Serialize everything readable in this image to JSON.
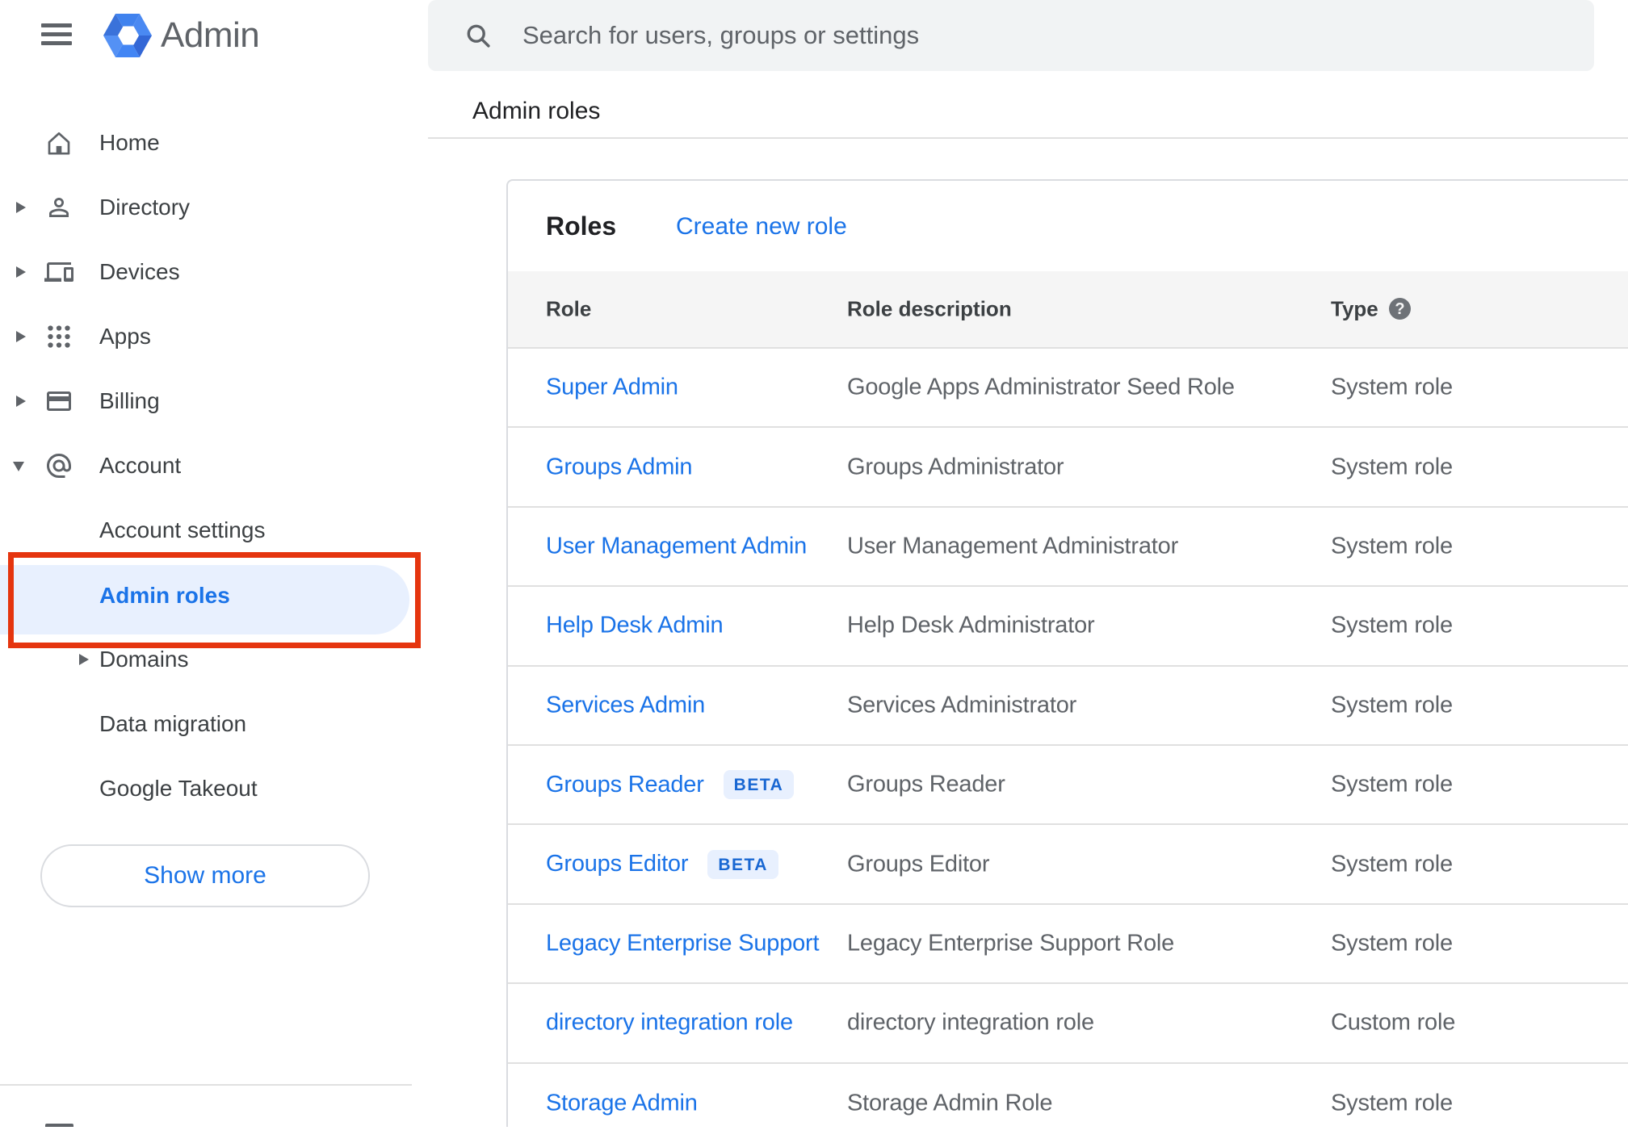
{
  "topbar": {
    "app_name": "Admin",
    "search_placeholder": "Search for users, groups or settings"
  },
  "breadcrumb": "Admin roles",
  "sidebar": {
    "items": [
      {
        "label": "Home",
        "icon": "home-icon",
        "expandable": false
      },
      {
        "label": "Directory",
        "icon": "person-icon",
        "expandable": true
      },
      {
        "label": "Devices",
        "icon": "devices-icon",
        "expandable": true
      },
      {
        "label": "Apps",
        "icon": "apps-grid-icon",
        "expandable": true
      },
      {
        "label": "Billing",
        "icon": "credit-card-icon",
        "expandable": true
      },
      {
        "label": "Account",
        "icon": "at-sign-icon",
        "expandable": true,
        "expanded": true
      }
    ],
    "account_sub_items": [
      {
        "label": "Account settings",
        "expandable": false,
        "selected": false
      },
      {
        "label": "Admin roles",
        "expandable": false,
        "selected": true
      },
      {
        "label": "Domains",
        "expandable": true,
        "selected": false
      },
      {
        "label": "Data migration",
        "expandable": false,
        "selected": false
      },
      {
        "label": "Google Takeout",
        "expandable": false,
        "selected": false
      }
    ],
    "show_more_label": "Show more"
  },
  "main": {
    "heading": "Roles",
    "create_link": "Create new role",
    "table": {
      "columns": [
        "Role",
        "Role description",
        "Type"
      ],
      "help_icon": "?",
      "rows": [
        {
          "role": "Super Admin",
          "description": "Google Apps Administrator Seed Role",
          "type": "System role"
        },
        {
          "role": "Groups Admin",
          "description": "Groups Administrator",
          "type": "System role"
        },
        {
          "role": "User Management Admin",
          "description": "User Management Administrator",
          "type": "System role"
        },
        {
          "role": "Help Desk Admin",
          "description": "Help Desk Administrator",
          "type": "System role"
        },
        {
          "role": "Services Admin",
          "description": "Services Administrator",
          "type": "System role"
        },
        {
          "role": "Groups Reader",
          "beta_label": "BETA",
          "description": "Groups Reader",
          "type": "System role"
        },
        {
          "role": "Groups Editor",
          "beta_label": "BETA",
          "description": "Groups Editor",
          "type": "System role"
        },
        {
          "role": "Legacy Enterprise Support",
          "description": "Legacy Enterprise Support Role",
          "type": "System role"
        },
        {
          "role": "directory integration role",
          "description": "directory integration role",
          "type": "Custom role"
        },
        {
          "role": "Storage Admin",
          "description": "Storage Admin Role",
          "type": "System role"
        }
      ]
    }
  },
  "annotation": {
    "highlight_color": "#e5350f",
    "highlighted_item": "Admin roles"
  },
  "colors": {
    "link_blue": "#1a73e8",
    "selected_pill_bg": "#e8f0fe",
    "search_bg": "#f1f3f4",
    "table_header_bg": "#f5f5f5",
    "divider": "#e0e0e0",
    "text_dark": "#202124",
    "text_gray": "#5f6368",
    "beta_text": "#1967d2",
    "annotation_red": "#e5350f"
  }
}
